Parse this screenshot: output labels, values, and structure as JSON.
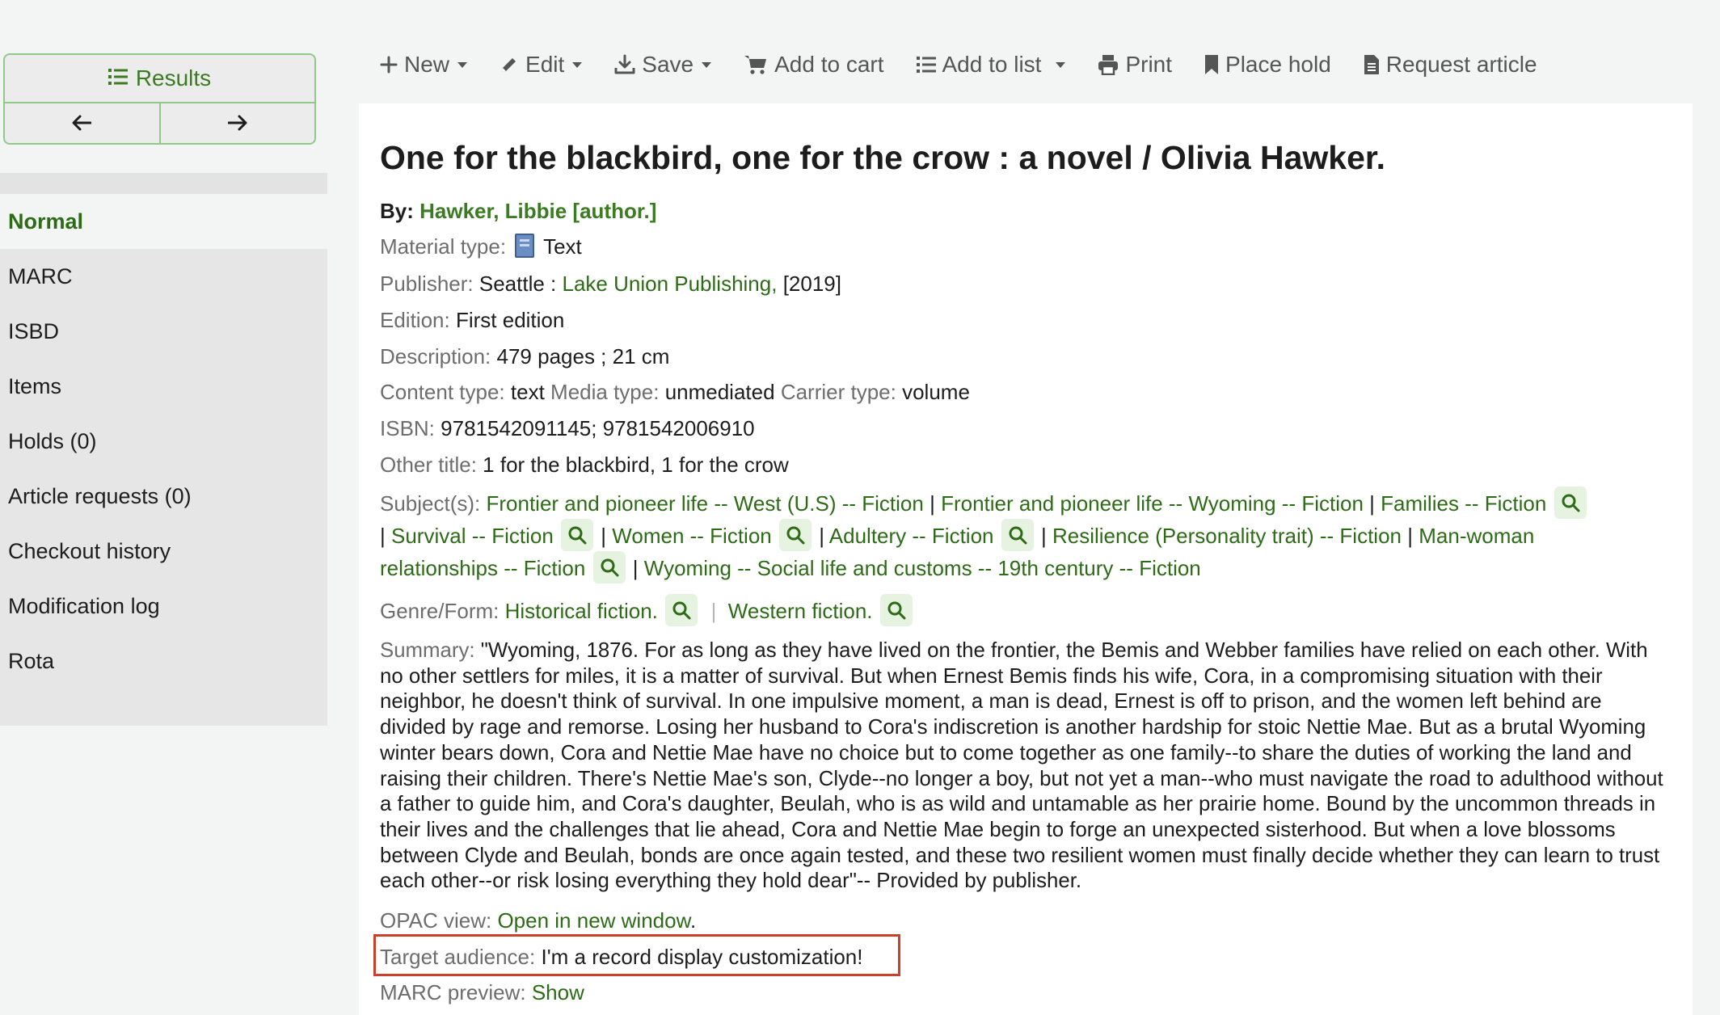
{
  "sidebar": {
    "results_label": "Results",
    "menu": [
      {
        "label": "Normal",
        "active": true
      },
      {
        "label": "MARC",
        "active": false
      },
      {
        "label": "ISBD",
        "active": false
      },
      {
        "label": "Items",
        "active": false
      },
      {
        "label": "Holds (0)",
        "active": false
      },
      {
        "label": "Article requests (0)",
        "active": false
      },
      {
        "label": "Checkout history",
        "active": false
      },
      {
        "label": "Modification log",
        "active": false
      },
      {
        "label": "Rota",
        "active": false
      }
    ]
  },
  "toolbar": {
    "new": "New",
    "edit": "Edit",
    "save": "Save",
    "add_to_cart": "Add to cart",
    "add_to_list": "Add to list",
    "print": "Print",
    "place_hold": "Place hold",
    "request_article": "Request article"
  },
  "record": {
    "title": "One for the blackbird, one for the crow : a novel / Olivia Hawker.",
    "by_label": "By:",
    "author": "Hawker, Libbie [author.]",
    "material_type_label": "Material type:",
    "material_type": "Text",
    "publisher_label": "Publisher:",
    "publisher_place": "Seattle :",
    "publisher_name": "Lake Union Publishing,",
    "publisher_date": "[2019]",
    "edition_label": "Edition:",
    "edition": "First edition",
    "description_label": "Description:",
    "description": "479 pages ; 21 cm",
    "content_type_label": "Content type:",
    "content_type": "text",
    "media_type_label": "Media type:",
    "media_type": "unmediated",
    "carrier_type_label": "Carrier type:",
    "carrier_type": "volume",
    "isbn_label": "ISBN:",
    "isbn": "9781542091145; 9781542006910",
    "other_title_label": "Other title:",
    "other_title": "1 for the blackbird, 1 for the crow",
    "subjects_label": "Subject(s):",
    "subjects": [
      "Frontier and pioneer life -- West (U.S) -- Fiction",
      "Frontier and pioneer life -- Wyoming -- Fiction",
      "Families -- Fiction",
      "Survival -- Fiction",
      "Women -- Fiction",
      "Adultery -- Fiction",
      "Resilience (Personality trait) -- Fiction",
      "Man-woman",
      "relationships -- Fiction",
      "Wyoming -- Social life and customs -- 19th century -- Fiction"
    ],
    "genre_label": "Genre/Form:",
    "genres": [
      "Historical fiction.",
      "Western fiction."
    ],
    "summary_label": "Summary:",
    "summary": "\"Wyoming, 1876. For as long as they have lived on the frontier, the Bemis and Webber families have relied on each other. With no other settlers for miles, it is a matter of survival. But when Ernest Bemis finds his wife, Cora, in a compromising situation with their neighbor, he doesn't think of survival. In one impulsive moment, a man is dead, Ernest is off to prison, and the women left behind are divided by rage and remorse. Losing her husband to Cora's indiscretion is another hardship for stoic Nettie Mae. But as a brutal Wyoming winter bears down, Cora and Nettie Mae have no choice but to come together as one family--to share the duties of working the land and raising their children. There's Nettie Mae's son, Clyde--no longer a boy, but not yet a man--who must navigate the road to adulthood without a father to guide him, and Cora's daughter, Beulah, who is as wild and untamable as her prairie home. Bound by the uncommon threads in their lives and the challenges that lie ahead, Cora and Nettie Mae begin to forge an unexpected sisterhood. But when a love blossoms between Clyde and Beulah, bonds are once again tested, and these two resilient women must finally decide whether they can learn to trust each other--or risk losing everything they hold dear\"-- Provided by publisher.",
    "opac_label": "OPAC view:",
    "opac_link": "Open in new window",
    "opac_period": ".",
    "target_audience_label": "Target audience:",
    "target_audience": "I'm a record display customization!",
    "marc_preview_label": "MARC preview:",
    "marc_preview_link": "Show"
  },
  "colors": {
    "link_green": "#2e6b17",
    "highlight_red": "#c9412b"
  }
}
